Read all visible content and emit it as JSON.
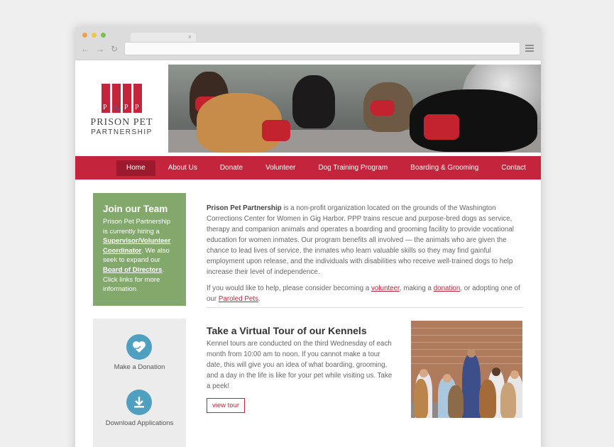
{
  "browser": {
    "traffic_lights": [
      "#f0a04b",
      "#f3c642",
      "#79c050"
    ],
    "tab_close": "×",
    "nav_icons": [
      "←",
      "→",
      "↻"
    ]
  },
  "logo": {
    "name": "PRISON PET",
    "sub": "PARTNERSHIP",
    "letters": [
      "P",
      "🐾",
      "P",
      "P"
    ]
  },
  "nav": {
    "items": [
      "Home",
      "About Us",
      "Donate",
      "Volunteer",
      "Dog Training Program",
      "Boarding & Grooming",
      "Contact"
    ]
  },
  "sidebar": {
    "team_title": "Join our Team",
    "team_text_1": "Prison Pet Partnership is currently hiring a ",
    "team_link_1": "Supervisor/Volunteer Coordinator",
    "team_text_2": ". We also seek to expand our ",
    "team_link_2": "Board of Directors",
    "team_text_3": ". Click links for more information.",
    "donation_label": "Make a Donation",
    "download_label": "Download Applications"
  },
  "main": {
    "org_name": "Prison Pet Partnership",
    "intro": " is a non-profit organization located on the grounds of the Washington Corrections Center for Women in Gig Harbor. PPP trains rescue and purpose-bred dogs as service, therapy and companion animals and operates a boarding and grooming facility to provide vocational education for women inmates. Our program benefits all involved — the animals who are given the chance to lead lives of service, the inmates who learn valuable skills so they may find gainful employment upon release, and the individuals with disabilities who receive well-trained dogs to help increase their level of independence.",
    "help_1": "If you would like to help, please consider becoming a ",
    "help_link_volunteer": "volunteer",
    "help_2": ", making a ",
    "help_link_donation": "donation",
    "help_3": ", or adopting one of our ",
    "help_link_paroled": "Paroled Pets",
    "help_4": "."
  },
  "tour": {
    "title": "Take a Virtual Tour of our Kennels",
    "text": "Kennel tours are conducted on the third Wednesday of each month from 10:00 am to noon. If you cannot make a tour date, this will give you an idea of what boarding, grooming, and a day in the life is like for your pet while visiting us. Take a peek!",
    "button": "view tour"
  },
  "colors": {
    "brand_red": "#c4243c",
    "nav_active": "#9b1a2d",
    "green": "#83a86b",
    "icon_blue": "#4fa0c0"
  }
}
